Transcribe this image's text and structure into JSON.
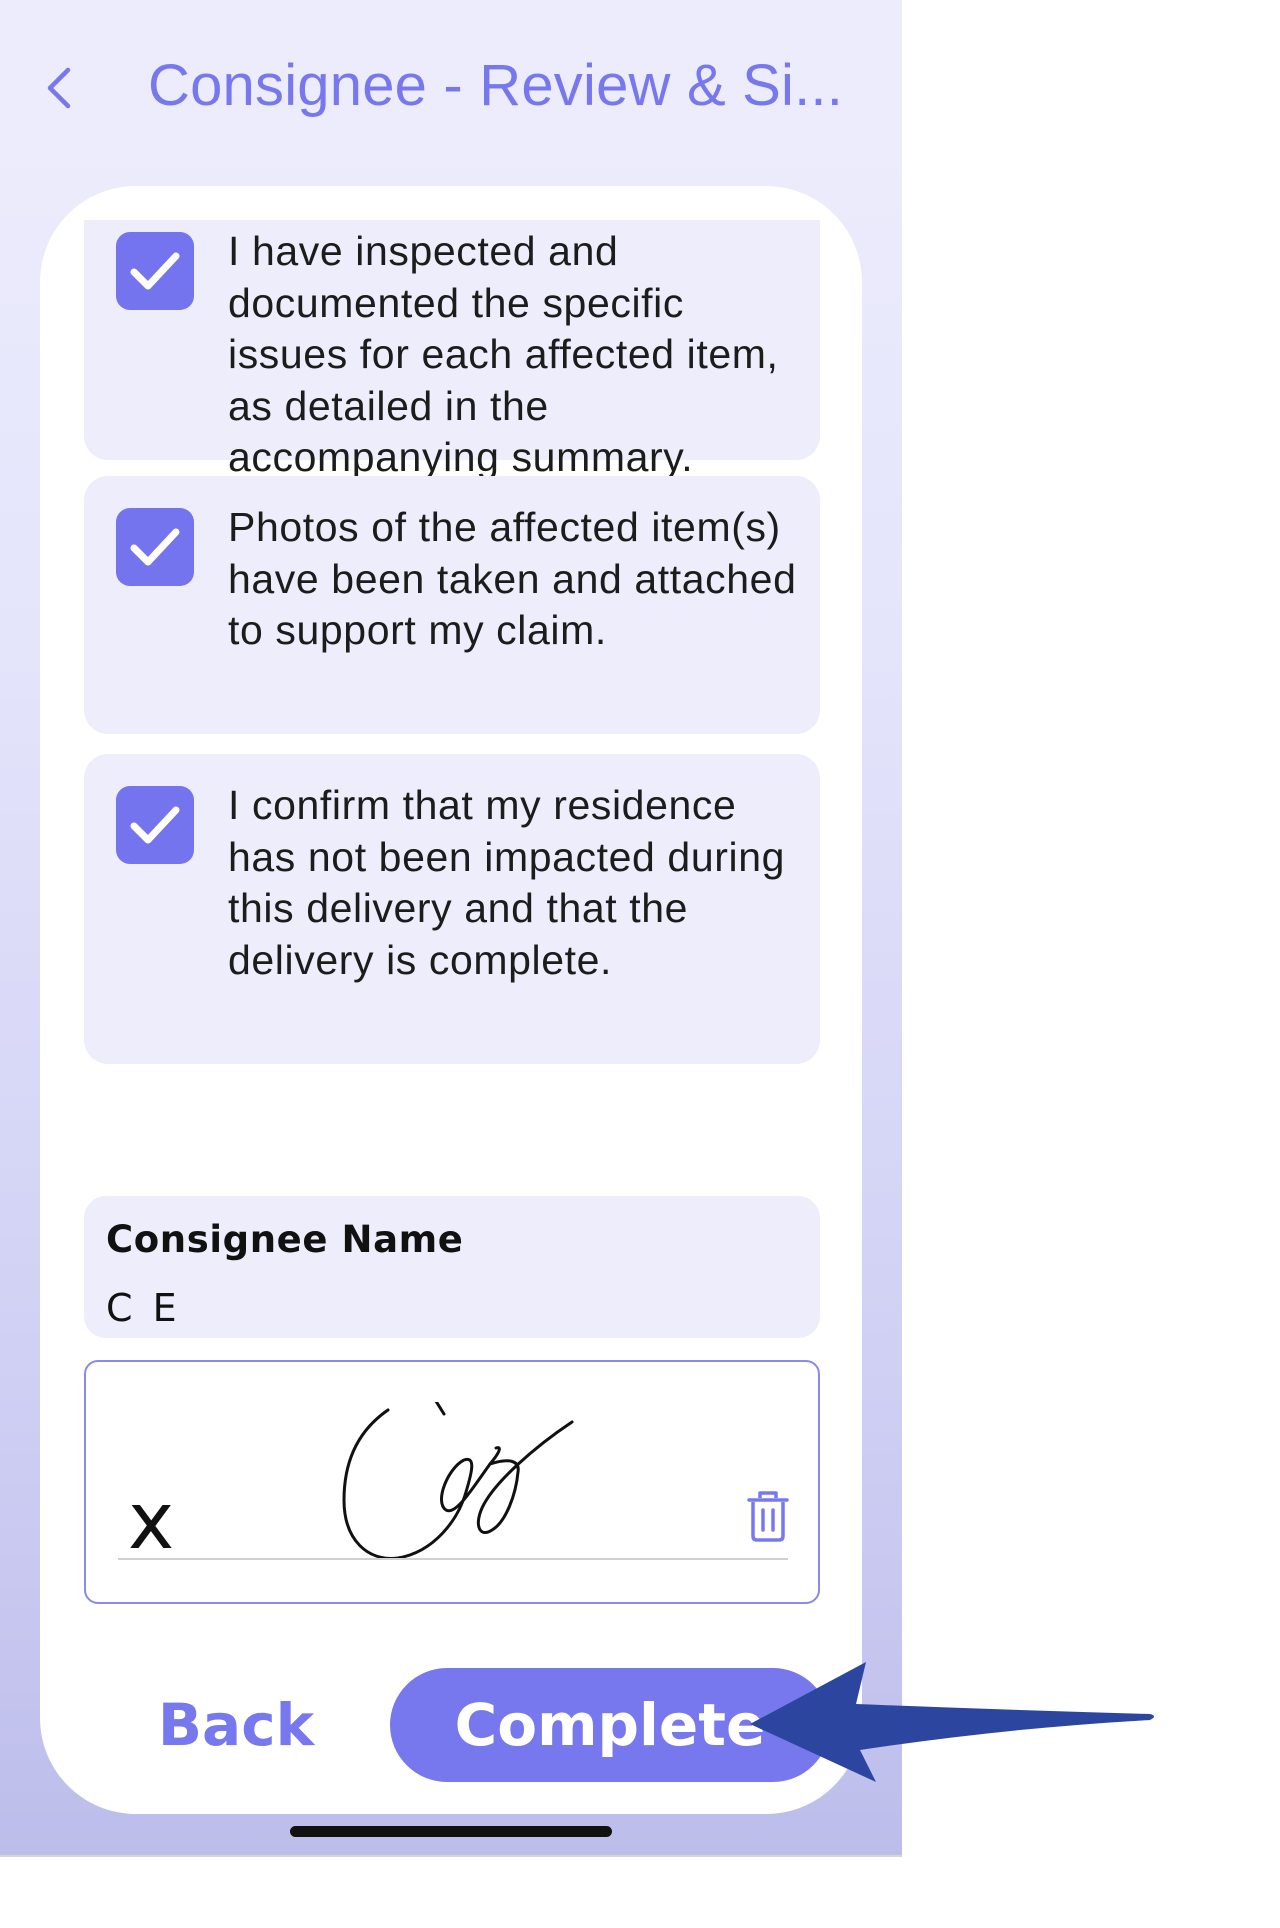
{
  "header": {
    "title": "Consignee - Review & Si..."
  },
  "checklist": [
    {
      "checked": true,
      "text": "I have inspected and documented the specific issues for each affected item, as detailed in the accompanying summary."
    },
    {
      "checked": true,
      "text": "Photos of the affected item(s) have been taken and attached to support my claim."
    },
    {
      "checked": true,
      "text": "I confirm that my residence has not been impacted during this delivery and that the delivery is complete."
    }
  ],
  "consignee": {
    "label": "Consignee Name",
    "value": "C E"
  },
  "signature": {
    "marker": "x"
  },
  "actions": {
    "back_label": "Back",
    "complete_label": "Complete"
  },
  "colors": {
    "accent": "#7878ee",
    "item_background": "#ededfc",
    "annotation_arrow": "#2c46a0"
  },
  "icons": {
    "back": "chevron-left-icon",
    "check": "checkmark-icon",
    "delete": "trash-icon"
  }
}
